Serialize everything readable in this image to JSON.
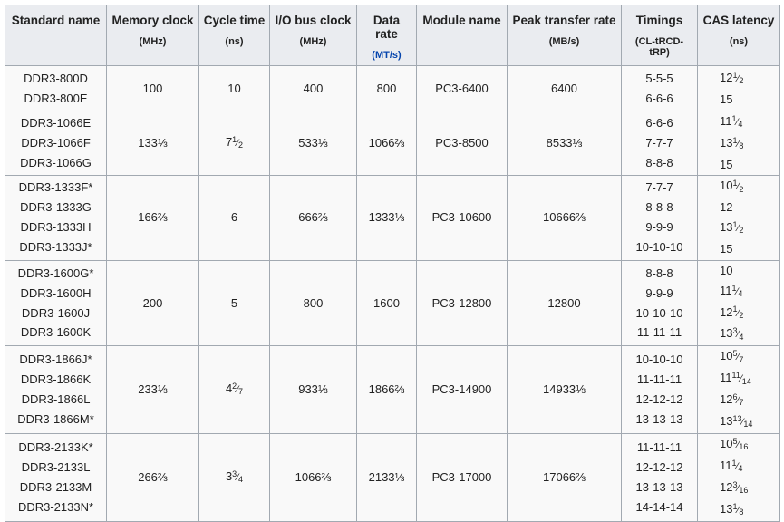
{
  "headers": [
    {
      "label": "Standard name",
      "unit": "",
      "unit_link": false
    },
    {
      "label": "Memory clock",
      "unit": "(MHz)",
      "unit_link": false
    },
    {
      "label": "Cycle time",
      "unit": "(ns)",
      "unit_link": false
    },
    {
      "label": "I/O bus clock",
      "unit": "(MHz)",
      "unit_link": false
    },
    {
      "label": "Data rate",
      "unit": "(MT/s)",
      "unit_link": true
    },
    {
      "label": "Module name",
      "unit": "",
      "unit_link": false
    },
    {
      "label": "Peak transfer rate",
      "unit": "(MB/s)",
      "unit_link": false
    },
    {
      "label": "Timings",
      "unit": "(CL-tRCD-tRP)",
      "unit_link": false
    },
    {
      "label": "CAS latency",
      "unit": "(ns)",
      "unit_link": false
    }
  ],
  "groups": [
    {
      "standards": [
        "DDR3-800D",
        "DDR3-800E"
      ],
      "memory_clock": "100",
      "cycle_time": {
        "w": "10"
      },
      "io_clock": "400",
      "data_rate": "800",
      "module": "PC3-6400",
      "peak": "6400",
      "timings": [
        "5-5-5",
        "6-6-6"
      ],
      "cas": [
        {
          "w": "12",
          "n": "1",
          "d": "2"
        },
        {
          "w": "15"
        }
      ]
    },
    {
      "standards": [
        "DDR3-1066E",
        "DDR3-1066F",
        "DDR3-1066G"
      ],
      "memory_clock": "133⅓",
      "cycle_time": {
        "w": "7",
        "n": "1",
        "d": "2"
      },
      "io_clock": "533⅓",
      "data_rate": "1066⅔",
      "module": "PC3-8500",
      "peak": "8533⅓",
      "timings": [
        "6-6-6",
        "7-7-7",
        "8-8-8"
      ],
      "cas": [
        {
          "w": "11",
          "n": "1",
          "d": "4"
        },
        {
          "w": "13",
          "n": "1",
          "d": "8"
        },
        {
          "w": "15"
        }
      ]
    },
    {
      "standards": [
        "DDR3-1333F*",
        "DDR3-1333G",
        "DDR3-1333H",
        "DDR3-1333J*"
      ],
      "memory_clock": "166⅔",
      "cycle_time": {
        "w": "6"
      },
      "io_clock": "666⅔",
      "data_rate": "1333⅓",
      "module": "PC3-10600",
      "peak": "10666⅔",
      "timings": [
        "7-7-7",
        "8-8-8",
        "9-9-9",
        "10-10-10"
      ],
      "cas": [
        {
          "w": "10",
          "n": "1",
          "d": "2"
        },
        {
          "w": "12"
        },
        {
          "w": "13",
          "n": "1",
          "d": "2"
        },
        {
          "w": "15"
        }
      ]
    },
    {
      "standards": [
        "DDR3-1600G*",
        "DDR3-1600H",
        "DDR3-1600J",
        "DDR3-1600K"
      ],
      "memory_clock": "200",
      "cycle_time": {
        "w": "5"
      },
      "io_clock": "800",
      "data_rate": "1600",
      "module": "PC3-12800",
      "peak": "12800",
      "timings": [
        "8-8-8",
        "9-9-9",
        "10-10-10",
        "11-11-11"
      ],
      "cas": [
        {
          "w": "10"
        },
        {
          "w": "11",
          "n": "1",
          "d": "4"
        },
        {
          "w": "12",
          "n": "1",
          "d": "2"
        },
        {
          "w": "13",
          "n": "3",
          "d": "4"
        }
      ]
    },
    {
      "standards": [
        "DDR3-1866J*",
        "DDR3-1866K",
        "DDR3-1866L",
        "DDR3-1866M*"
      ],
      "memory_clock": "233⅓",
      "cycle_time": {
        "w": "4",
        "n": "2",
        "d": "7"
      },
      "io_clock": "933⅓",
      "data_rate": "1866⅔",
      "module": "PC3-14900",
      "peak": "14933⅓",
      "timings": [
        "10-10-10",
        "11-11-11",
        "12-12-12",
        "13-13-13"
      ],
      "cas": [
        {
          "w": "10",
          "n": "5",
          "d": "7"
        },
        {
          "w": "11",
          "n": "11",
          "d": "14"
        },
        {
          "w": "12",
          "n": "6",
          "d": "7"
        },
        {
          "w": "13",
          "n": "13",
          "d": "14"
        }
      ]
    },
    {
      "standards": [
        "DDR3-2133K*",
        "DDR3-2133L",
        "DDR3-2133M",
        "DDR3-2133N*"
      ],
      "memory_clock": "266⅔",
      "cycle_time": {
        "w": "3",
        "n": "3",
        "d": "4"
      },
      "io_clock": "1066⅔",
      "data_rate": "2133⅓",
      "module": "PC3-17000",
      "peak": "17066⅔",
      "timings": [
        "11-11-11",
        "12-12-12",
        "13-13-13",
        "14-14-14"
      ],
      "cas": [
        {
          "w": "10",
          "n": "5",
          "d": "16"
        },
        {
          "w": "11",
          "n": "1",
          "d": "4"
        },
        {
          "w": "12",
          "n": "3",
          "d": "16"
        },
        {
          "w": "13",
          "n": "1",
          "d": "8"
        }
      ]
    }
  ]
}
